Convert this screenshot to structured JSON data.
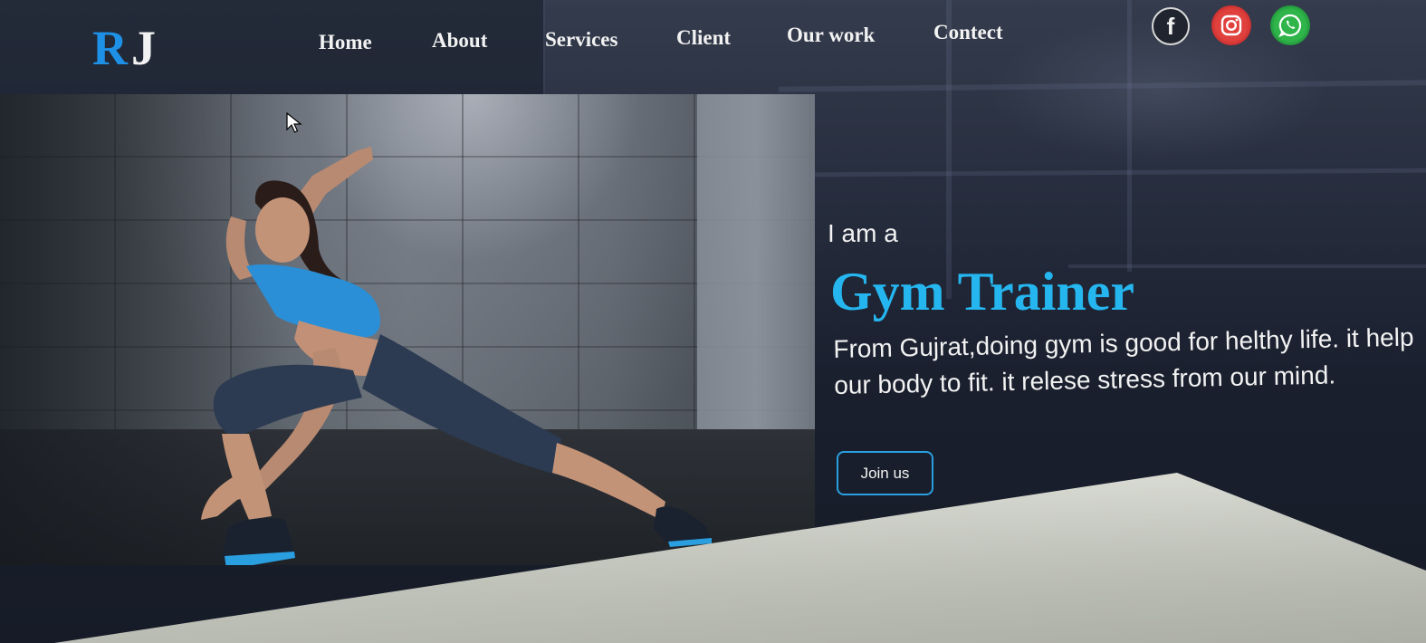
{
  "logo": {
    "first": "R",
    "second": "J"
  },
  "nav": {
    "items": [
      {
        "label": "Home"
      },
      {
        "label": "About"
      },
      {
        "label": "Services"
      },
      {
        "label": "Client"
      },
      {
        "label": "Our work"
      },
      {
        "label": "Contect"
      }
    ]
  },
  "social": {
    "facebook_icon": "facebook-icon",
    "instagram_icon": "instagram-icon",
    "whatsapp_icon": "whatsapp-icon",
    "facebook_letter": "f"
  },
  "hero": {
    "subtitle": "I am a",
    "headline": "Gym Trainer",
    "description": "From Gujrat,doing gym is good for helthy life. it help our body to fit. it relese stress from our mind.",
    "button_label": "Join us"
  },
  "colors": {
    "accent": "#25b6ef",
    "logo_blue": "#1e90e6",
    "button_border": "#2a9fe0",
    "text": "#f2f2f2"
  }
}
